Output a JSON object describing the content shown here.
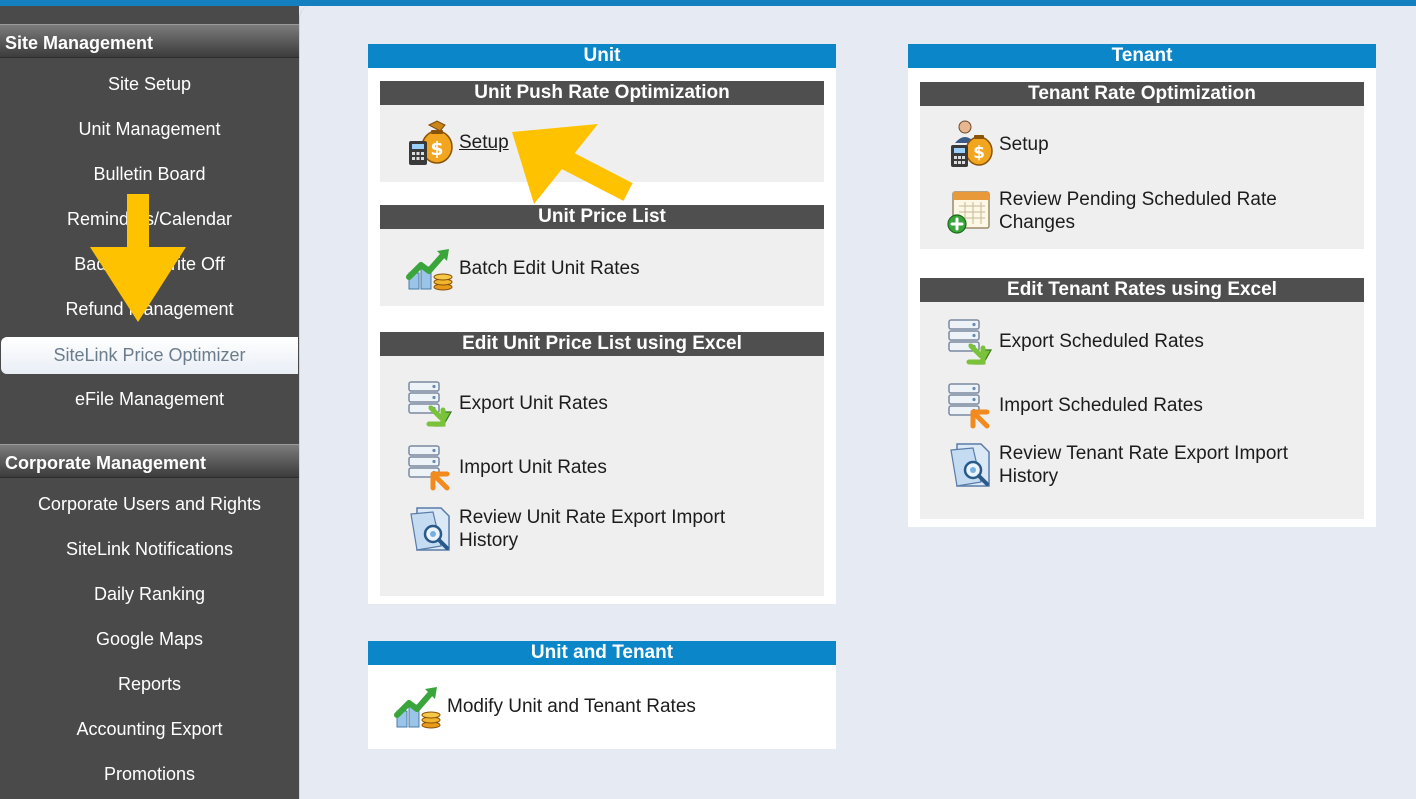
{
  "sidebar": {
    "site_header": "Site Management",
    "site_items": [
      "Site Setup",
      "Unit Management",
      "Bulletin Board",
      "Reminders/Calendar",
      "Bad Debt Write Off",
      "Refund Management",
      "SiteLink Price Optimizer",
      "eFile Management"
    ],
    "active_item": "SiteLink Price Optimizer",
    "corp_header": "Corporate Management",
    "corp_items": [
      "Corporate Users and Rights",
      "SiteLink Notifications",
      "Daily Ranking",
      "Google Maps",
      "Reports",
      "Accounting Export",
      "Promotions"
    ]
  },
  "unit": {
    "title": "Unit",
    "push": {
      "title": "Unit Push Rate Optimization",
      "setup": "Setup"
    },
    "price_list": {
      "title": "Unit Price List",
      "batch_edit": "Batch Edit Unit Rates"
    },
    "excel": {
      "title": "Edit Unit Price List using Excel",
      "export": "Export Unit Rates",
      "import": "Import Unit Rates",
      "review_line1": "Review Unit Rate Export Import",
      "review_line2": "History"
    }
  },
  "unit_tenant": {
    "title": "Unit and Tenant",
    "modify": "Modify Unit and Tenant Rates"
  },
  "tenant": {
    "title": "Tenant",
    "rate_opt": {
      "title": "Tenant Rate Optimization",
      "setup": "Setup",
      "review_line1": "Review Pending Scheduled Rate",
      "review_line2": "Changes"
    },
    "excel": {
      "title": "Edit Tenant Rates using Excel",
      "export": "Export Scheduled Rates",
      "import": "Import Scheduled Rates",
      "review_line1": "Review Tenant Rate Export Import",
      "review_line2": "History"
    }
  },
  "colors": {
    "accent_blue": "#0b86c8",
    "subheader_gray": "#4f4f4f",
    "sidebar_bg": "#4a4a4a",
    "highlight_arrow": "#ffc200"
  }
}
